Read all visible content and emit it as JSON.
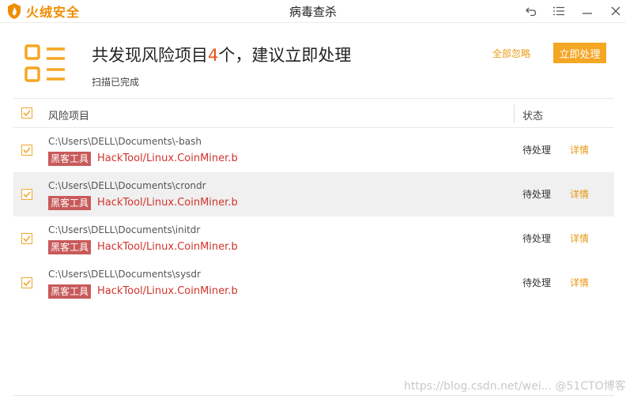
{
  "app": {
    "brand_name": "火绒安全",
    "window_title": "病毒查杀",
    "brand_color": "#f08c00",
    "accent_color": "#f5a623",
    "controls": [
      "back-icon",
      "menu-icon",
      "minimize-icon",
      "close-icon"
    ]
  },
  "summary": {
    "title_prefix": "共发现风险项目",
    "count": "4",
    "title_suffix": "个，建议立即处理",
    "status": "扫描已完成",
    "ignore_all": "全部忽略",
    "fix_now": "立即处理"
  },
  "table": {
    "headers": {
      "risk": "风险项目",
      "status": "状态"
    },
    "rows": [
      {
        "path": "C:\\Users\\DELL\\Documents\\-bash",
        "tag": "黑客工具",
        "threat": "HackTool/Linux.CoinMiner.b",
        "status": "待处理",
        "details": "详情",
        "checked": true
      },
      {
        "path": "C:\\Users\\DELL\\Documents\\crondr",
        "tag": "黑客工具",
        "threat": "HackTool/Linux.CoinMiner.b",
        "status": "待处理",
        "details": "详情",
        "checked": true
      },
      {
        "path": "C:\\Users\\DELL\\Documents\\initdr",
        "tag": "黑客工具",
        "threat": "HackTool/Linux.CoinMiner.b",
        "status": "待处理",
        "details": "详情",
        "checked": true
      },
      {
        "path": "C:\\Users\\DELL\\Documents\\sysdr",
        "tag": "黑客工具",
        "threat": "HackTool/Linux.CoinMiner.b",
        "status": "待处理",
        "details": "详情",
        "checked": true
      }
    ]
  },
  "watermark": "https://blog.csdn.net/wei... @51CTO博客"
}
